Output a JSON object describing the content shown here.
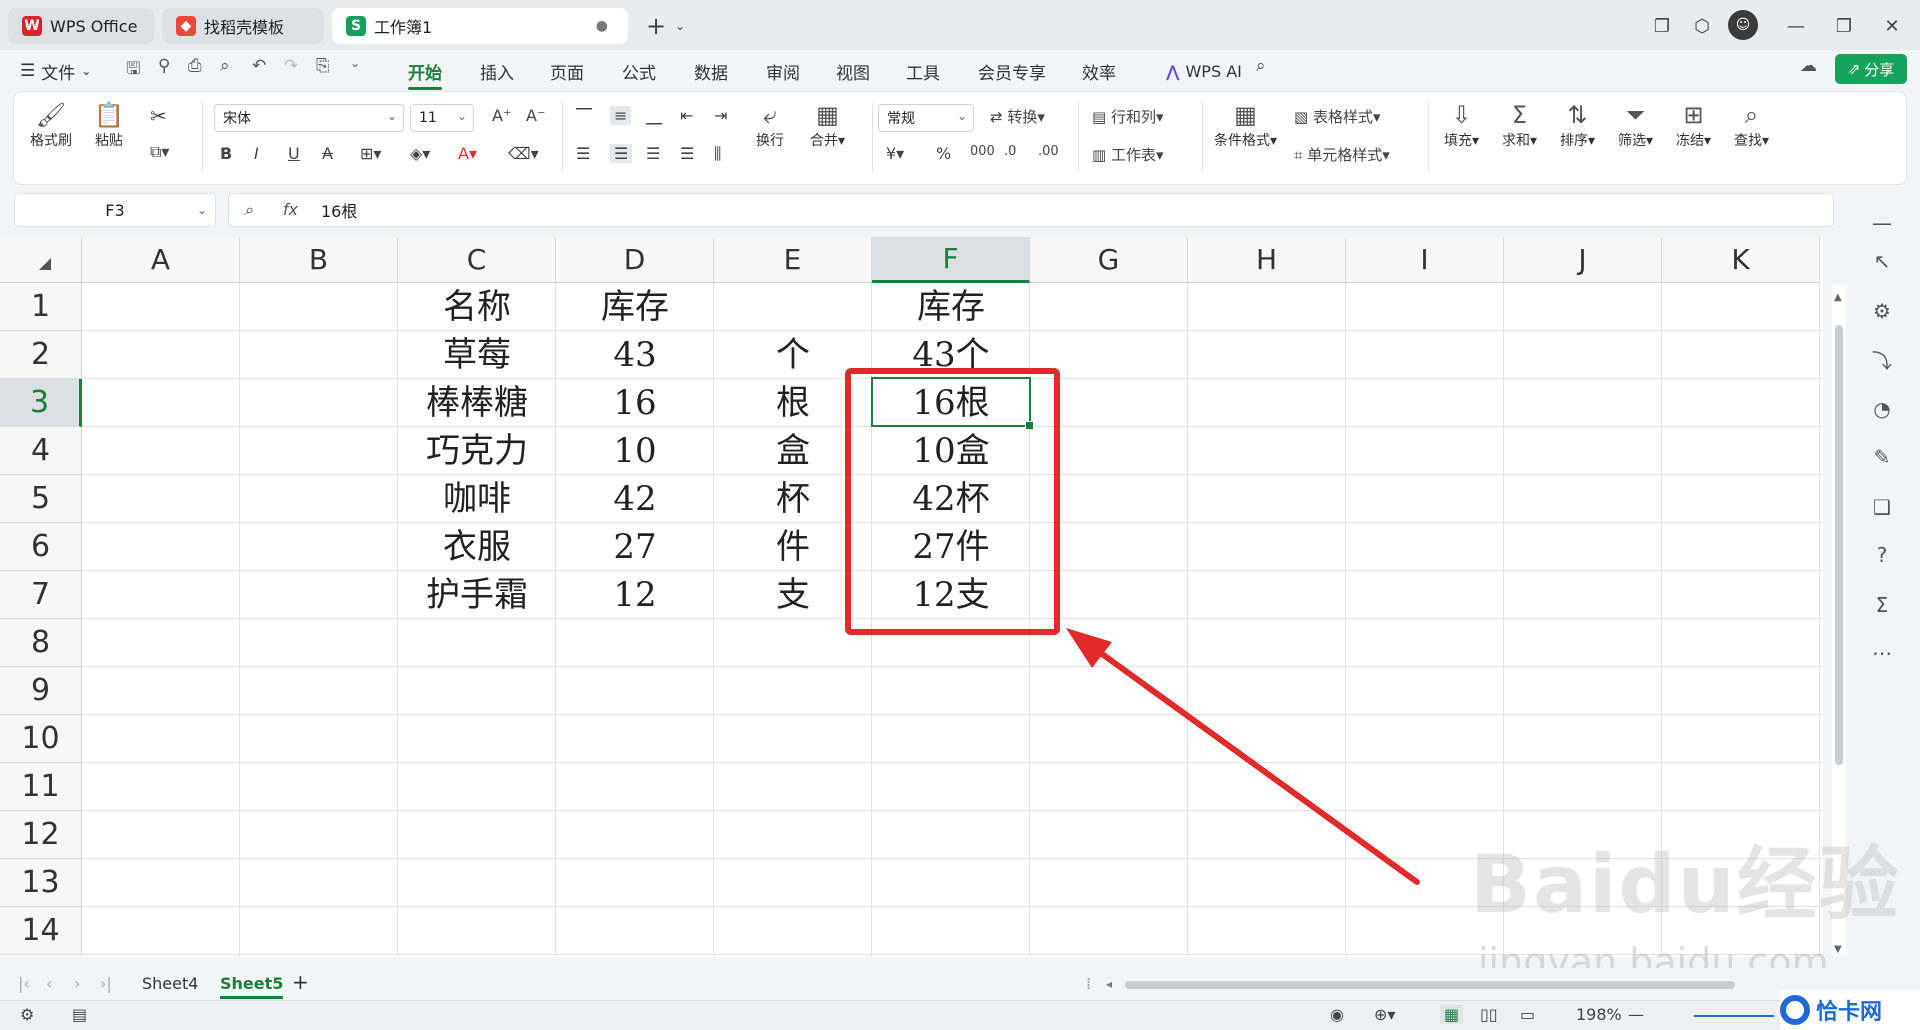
{
  "tabs": [
    {
      "label": "WPS Office"
    },
    {
      "label": "找稻壳模板"
    },
    {
      "label": "工作簿1"
    }
  ],
  "new_tab": "+",
  "menu": {
    "file": "文件",
    "items": [
      "开始",
      "插入",
      "页面",
      "公式",
      "数据",
      "审阅",
      "视图",
      "工具",
      "会员专享",
      "效率"
    ],
    "active_index": 0,
    "wps_ai": "WPS AI",
    "share": "分享"
  },
  "ribbon": {
    "format_painter": "格式刷",
    "paste": "粘贴",
    "font_name": "宋体",
    "font_size": "11",
    "wrap": "换行",
    "merge": "合并",
    "number_format": "常规",
    "convert": "转换",
    "row_col": "行和列",
    "worksheet": "工作表",
    "conditional_format": "条件格式",
    "table_style": "表格样式",
    "cell_style": "单元格样式",
    "fill": "填充",
    "sum": "求和",
    "sort": "排序",
    "filter": "筛选",
    "freeze": "冻结",
    "find": "查找"
  },
  "formula_bar": {
    "cell_ref": "F3",
    "value": "16根"
  },
  "columns": [
    "A",
    "B",
    "C",
    "D",
    "E",
    "F",
    "G",
    "H",
    "I",
    "J",
    "K"
  ],
  "selected_column": "F",
  "rows": [
    "1",
    "2",
    "3",
    "4",
    "5",
    "6",
    "7",
    "8",
    "9",
    "10",
    "11",
    "12",
    "13",
    "14"
  ],
  "selected_row": "3",
  "cells": {
    "C": [
      "名称",
      "草莓",
      "棒棒糖",
      "巧克力",
      "咖啡",
      "衣服",
      "护手霜"
    ],
    "D": [
      "库存",
      "43",
      "16",
      "10",
      "42",
      "27",
      "12"
    ],
    "E": [
      "",
      "个",
      "根",
      "盒",
      "杯",
      "件",
      "支"
    ],
    "F": [
      "库存",
      "43个",
      "16根",
      "10盒",
      "42杯",
      "27件",
      "12支"
    ]
  },
  "sheets": [
    "Sheet4",
    "Sheet5"
  ],
  "active_sheet": "Sheet5",
  "status": {
    "zoom": "198%"
  },
  "watermark": {
    "baidu": "Baidu经验",
    "url": "jingyan.baidu.com",
    "qiaka": "恰卡网"
  },
  "colors": {
    "accent": "#1a7f3c",
    "highlight": "#e12a2a",
    "share_bg": "#16a35b"
  }
}
